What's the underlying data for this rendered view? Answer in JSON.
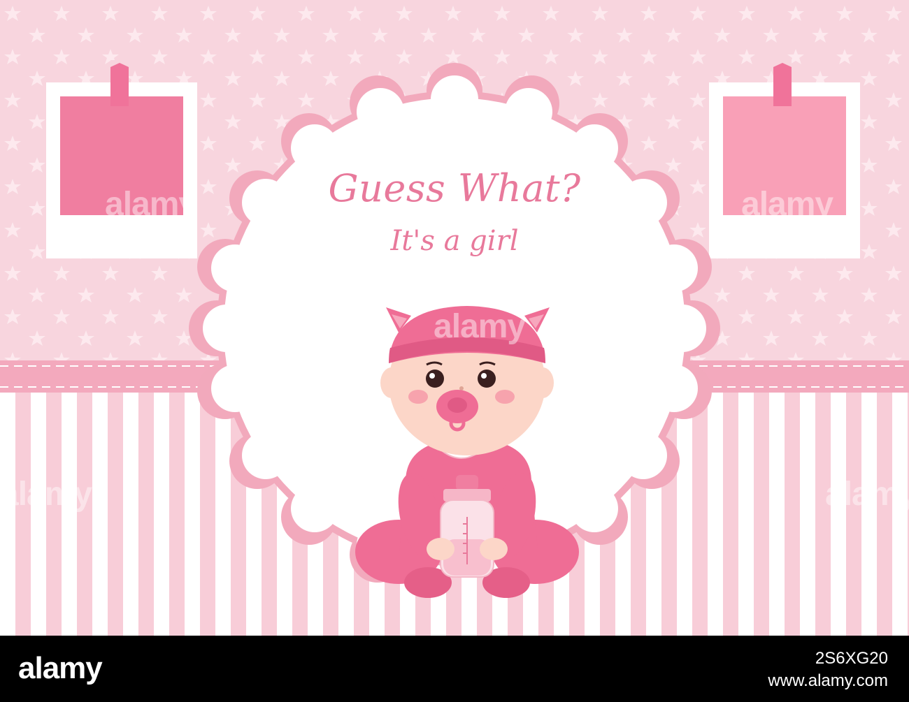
{
  "card": {
    "title": "Guess What?",
    "subtitle": "It's a girl"
  },
  "footer": {
    "logo": "alamy",
    "image_id": "2S6XG20",
    "url": "www.alamy.com"
  },
  "watermark": "alamy",
  "colors": {
    "background_pink": "#f7d3dc",
    "stripe_white": "#ffffff",
    "stripe_pink": "#f6c5d1",
    "ribbon": "#f3a9bd",
    "frame_inner": "#f07ea0",
    "text_pink": "#e8799b",
    "onesie": "#ef6d95"
  },
  "icons": [
    "star-pattern",
    "photo-frame",
    "ribbon-tape",
    "scalloped-badge",
    "baby-illustration",
    "baby-bottle"
  ]
}
